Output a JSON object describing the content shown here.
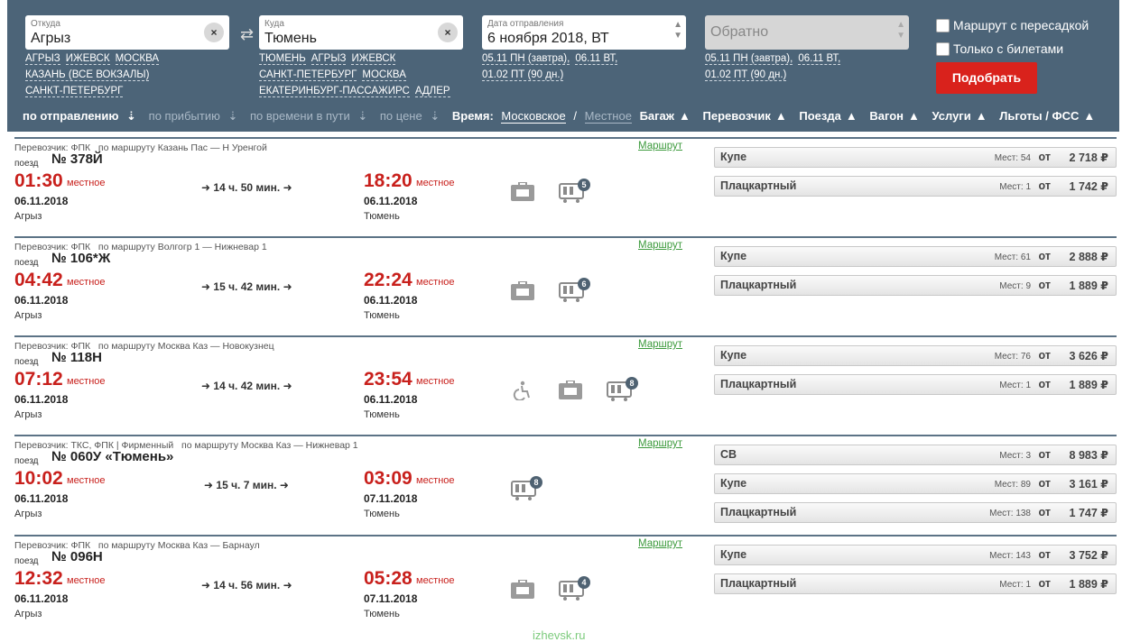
{
  "search": {
    "from": {
      "label": "Откуда",
      "value": "Агрыз",
      "clear": "×"
    },
    "to": {
      "label": "Куда",
      "value": "Тюмень",
      "clear": "×"
    },
    "swap": "⇄",
    "date": {
      "label": "Дата отправления",
      "value": "6 ноября 2018, ВТ"
    },
    "return_placeholder": "Обратно",
    "from_links": [
      "АГРЫЗ",
      "ИЖЕВСК",
      "МОСКВА",
      "КАЗАНЬ (ВСЕ ВОКЗАЛЫ)",
      "САНКТ-ПЕТЕРБУРГ"
    ],
    "to_links": [
      "ТЮМЕНЬ",
      "АГРЫЗ",
      "ИЖЕВСК",
      "САНКТ-ПЕТЕРБУРГ",
      "МОСКВА",
      "ЕКАТЕРИНБУРГ-ПАССАЖИРС",
      "АДЛЕР"
    ],
    "date_links": [
      "05.11 ПН (завтра),",
      "06.11 ВТ,",
      "01.02 ПТ (90 дн.)"
    ],
    "return_links": [
      "05.11 ПН (завтра),",
      "06.11 ВТ,",
      "01.02 ПТ (90 дн.)"
    ],
    "check_transfer": "Маршрут с пересадкой",
    "check_tickets": "Только с билетами",
    "submit": "Подобрать"
  },
  "sortbar": {
    "by_departure": "по отправлению",
    "by_arrival": "по прибытию",
    "by_travel_time": "по времени в пути",
    "by_price": "по цене",
    "time_label": "Время:",
    "time_moscow": "Московское",
    "time_local": "Местное",
    "slash": "/",
    "filters": [
      "Багаж",
      "Перевозчик",
      "Поезда",
      "Вагон",
      "Услуги",
      "Льготы / ФСС"
    ]
  },
  "common": {
    "train_label": "поезд",
    "route_link": "Маршрут",
    "tz": "местное",
    "seats_prefix": "Мест:",
    "from": "от"
  },
  "trains": [
    {
      "carrier": "Перевозчик: ФПК",
      "route": "по маршруту Казань Пас — Н Уренгой",
      "number": "№ 378Й",
      "dep_time": "01:30",
      "dep_date": "06.11.2018",
      "dep_city": "Агрыз",
      "duration": "14 ч. 50 мин.",
      "arr_time": "18:20",
      "arr_date": "06.11.2018",
      "arr_city": "Тюмень",
      "wagons": "5",
      "fares": [
        {
          "cls": "Купе",
          "seats": "54",
          "price": "2 718 ₽"
        },
        {
          "cls": "Плацкартный",
          "seats": "1",
          "price": "1 742 ₽"
        }
      ]
    },
    {
      "carrier": "Перевозчик: ФПК",
      "route": "по маршруту Волгогр 1 — Нижневар 1",
      "number": "№ 106*Ж",
      "dep_time": "04:42",
      "dep_date": "06.11.2018",
      "dep_city": "Агрыз",
      "duration": "15 ч. 42 мин.",
      "arr_time": "22:24",
      "arr_date": "06.11.2018",
      "arr_city": "Тюмень",
      "wagons": "6",
      "fares": [
        {
          "cls": "Купе",
          "seats": "61",
          "price": "2 888 ₽"
        },
        {
          "cls": "Плацкартный",
          "seats": "9",
          "price": "1 889 ₽"
        }
      ]
    },
    {
      "carrier": "Перевозчик: ФПК",
      "route": "по маршруту Москва Каз — Новокузнец",
      "number": "№ 118Н",
      "dep_time": "07:12",
      "dep_date": "06.11.2018",
      "dep_city": "Агрыз",
      "duration": "14 ч. 42 мин.",
      "arr_time": "23:54",
      "arr_date": "06.11.2018",
      "arr_city": "Тюмень",
      "wagons": "8",
      "fares": [
        {
          "cls": "Купе",
          "seats": "76",
          "price": "3 626 ₽"
        },
        {
          "cls": "Плацкартный",
          "seats": "1",
          "price": "1 889 ₽"
        }
      ]
    },
    {
      "carrier": "Перевозчик: ТКС, ФПК | Фирменный",
      "route": "по маршруту Москва Каз — Нижневар 1",
      "number": "№ 060У «Тюмень»",
      "dep_time": "10:02",
      "dep_date": "06.11.2018",
      "dep_city": "Агрыз",
      "duration": "15 ч. 7 мин.",
      "arr_time": "03:09",
      "arr_date": "07.11.2018",
      "arr_city": "Тюмень",
      "wagons": "8",
      "fares": [
        {
          "cls": "СВ",
          "seats": "3",
          "price": "8 983 ₽"
        },
        {
          "cls": "Купе",
          "seats": "89",
          "price": "3 161 ₽"
        },
        {
          "cls": "Плацкартный",
          "seats": "138",
          "price": "1 747 ₽"
        }
      ]
    },
    {
      "carrier": "Перевозчик: ФПК",
      "route": "по маршруту Москва Каз — Барнаул",
      "number": "№ 096Н",
      "dep_time": "12:32",
      "dep_date": "06.11.2018",
      "dep_city": "Агрыз",
      "duration": "14 ч. 56 мин.",
      "arr_time": "05:28",
      "arr_date": "07.11.2018",
      "arr_city": "Тюмень",
      "wagons": "4",
      "fares": [
        {
          "cls": "Купе",
          "seats": "143",
          "price": "3 752 ₽"
        },
        {
          "cls": "Плацкартный",
          "seats": "1",
          "price": "1 889 ₽"
        }
      ]
    }
  ],
  "watermark": "izhevsk.ru"
}
